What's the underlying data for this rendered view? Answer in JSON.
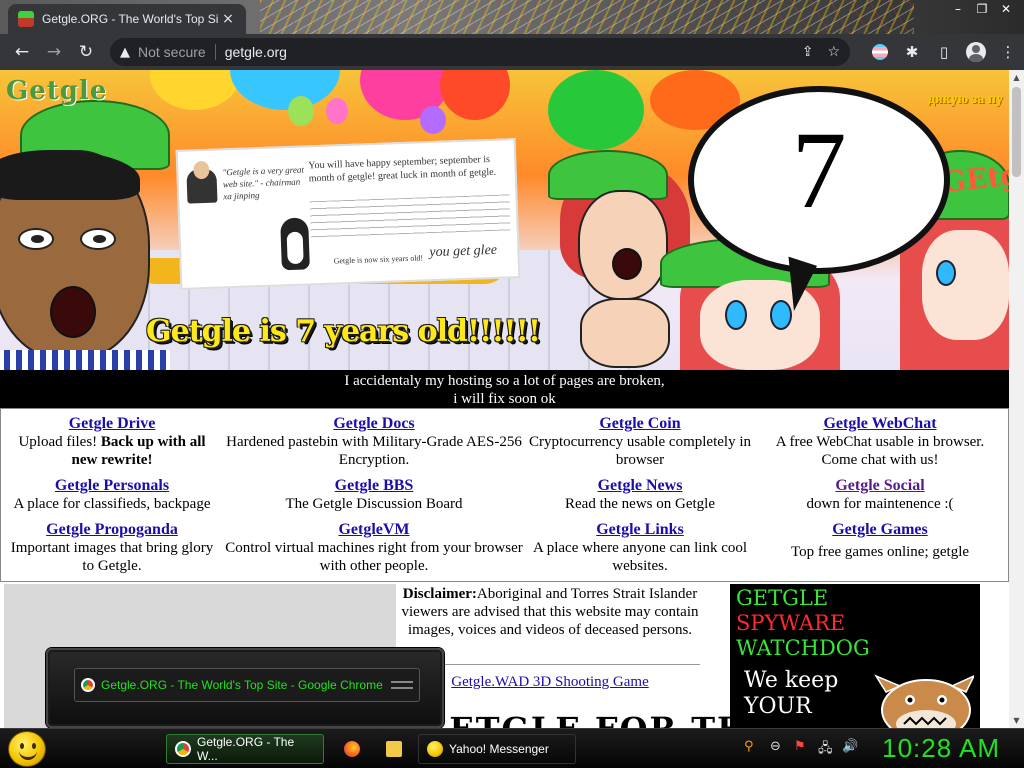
{
  "browser": {
    "tab_title": "Getgle.ORG - The World's Top Si",
    "tab_close": "×",
    "window_controls": [
      "–",
      "❐",
      "✕"
    ],
    "security_label": "Not secure",
    "url": "getgle.org",
    "nav": {
      "back": "←",
      "forward": "→",
      "reload": "↻"
    },
    "toolbar_icons": {
      "share": "⇪",
      "bookmark": "☆",
      "extensions": "✱",
      "sidepanel": "▯",
      "menu": "⋮"
    }
  },
  "banner": {
    "logo": "Getgle",
    "thanks": "дякую за пу",
    "poster_quote": "\"Getgle is a very great web site.\" - chairman xa jinping",
    "poster_msg": "You will have happy september; september is month of getgle! great luck in month of getgle.",
    "poster_small": "Getgle is now six years old!",
    "poster_glee": "you get glee",
    "headline": "Getgle is 7 years old!!!!!!",
    "bubble_number": "7",
    "cap_text": "GEtg"
  },
  "notice": {
    "line1": "I accidentaly my hosting so a lot of pages are broken,",
    "line2": "i will fix soon ok"
  },
  "services": [
    {
      "name": "Getgle Drive",
      "desc_pre": "Upload files! ",
      "desc_bold": "Back up with all new rewrite!",
      "visited": false
    },
    {
      "name": "Getgle Docs",
      "desc": "Hardened pastebin with Military-Grade AES-256 Encryption.",
      "visited": false
    },
    {
      "name": "Getgle Coin",
      "desc": "Cryptocurrency usable completely in browser",
      "visited": false
    },
    {
      "name": "Getgle WebChat",
      "desc": "A free WebChat usable in browser. Come chat with us!",
      "visited": false
    },
    {
      "name": "Getgle Personals",
      "desc": "A place for classifieds, backpage",
      "visited": false
    },
    {
      "name": "Getgle BBS",
      "desc": "The Getgle Discussion Board",
      "visited": false
    },
    {
      "name": "Getgle News",
      "desc": "Read the news on Getgle",
      "visited": false
    },
    {
      "name": "Getgle Social",
      "desc": "down for maintenence :(",
      "visited": true
    },
    {
      "name": "Getgle Propoganda",
      "desc": "Important images that bring glory to Getgle.",
      "visited": false
    },
    {
      "name": "GetgleVM",
      "desc": "Control virtual machines right from your browser with other people.",
      "visited": false
    },
    {
      "name": "Getgle Links",
      "desc": "A place where anyone can link cool websites.",
      "visited": false
    },
    {
      "name": "Getgle Games",
      "desc": "Top free games online; getgle",
      "visited": false
    }
  ],
  "disclaimer": {
    "label": "Disclaimer:",
    "text": "Aboriginal and Torres Strait Islander viewers are advised that this website may contain images, voices and videos of deceased persons."
  },
  "wad_link": "Getgle.WAD 3D Shooting Game",
  "big_text": "GETGLE FOR THE",
  "spyware_ad": {
    "line1": "GETGLE",
    "line2": "SPYWARE",
    "line3": "WATCHDOG",
    "line4": "We keep",
    "line5": "YOUR"
  },
  "taskbar": {
    "preview_title": "Getgle.ORG - The World's Top Site - Google Chrome",
    "task_chrome": "Getgle.ORG - The W...",
    "task_yahoo": "Yahoo! Messenger",
    "clock": "10:28 AM",
    "tray_icons": {
      "search": "⚲",
      "minus": "⊖",
      "flag": "⚑",
      "network": "🖧",
      "volume": "🔊"
    }
  }
}
